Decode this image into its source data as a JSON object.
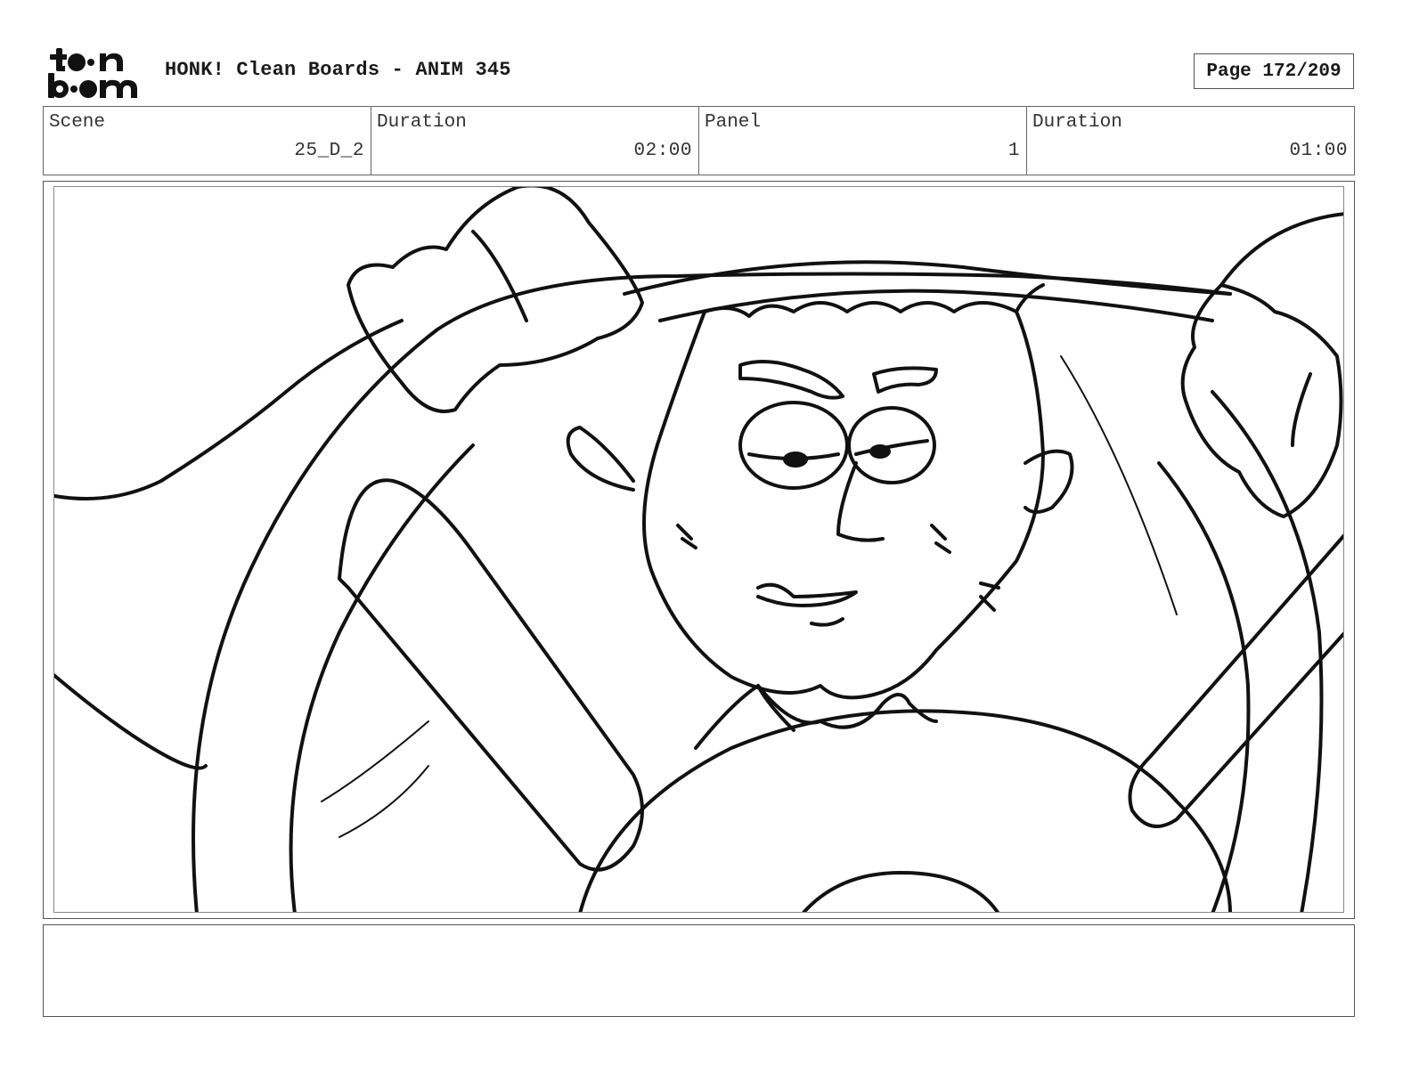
{
  "header": {
    "logo_name": "toon-boom-logo",
    "title": "HONK! Clean Boards - ANIM 345",
    "page_label": "Page 172/209"
  },
  "info": {
    "scene_label": "Scene",
    "scene_value": "25_D_2",
    "scene_duration_label": "Duration",
    "scene_duration_value": "02:00",
    "panel_label": "Panel",
    "panel_value": "1",
    "panel_duration_label": "Duration",
    "panel_duration_value": "01:00"
  },
  "notes": {
    "text": ""
  }
}
